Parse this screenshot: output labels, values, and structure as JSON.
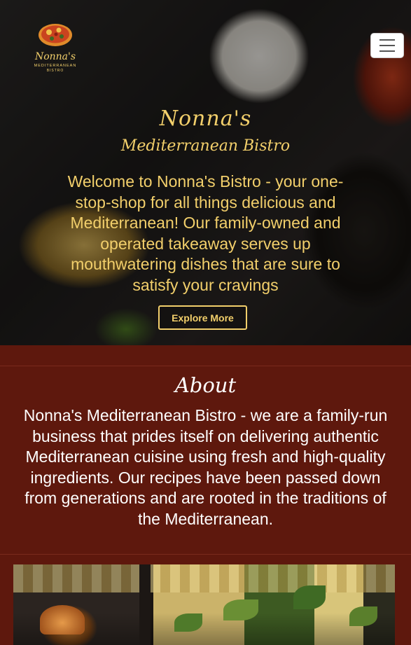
{
  "header": {
    "logo": {
      "line1": "Nonna's",
      "line2": "MEDITERRANEAN",
      "line3": "BISTRO"
    },
    "menu_button": {
      "icon": "hamburger-icon"
    }
  },
  "hero": {
    "title": "Nonna's",
    "subtitle": "Mediterranean Bistro",
    "text": "Welcome to Nonna's Bistro - your one-stop-shop for all things delicious and Mediterranean! Our family-owned and operated takeaway serves up mouthwatering dishes that are sure to satisfy your cravings",
    "cta_label": "Explore More"
  },
  "about": {
    "title": "About",
    "text": "Nonna's Mediterranean Bistro - we are a family-run business that prides itself on delivering authentic Mediterranean cuisine using fresh and high-quality ingredients. Our recipes have been passed down from generations and are rooted in the traditions of the Mediterranean."
  },
  "colors": {
    "accent_gold": "#f2cf6b",
    "section_bg": "#5e180d",
    "text_light": "#ffffff"
  }
}
